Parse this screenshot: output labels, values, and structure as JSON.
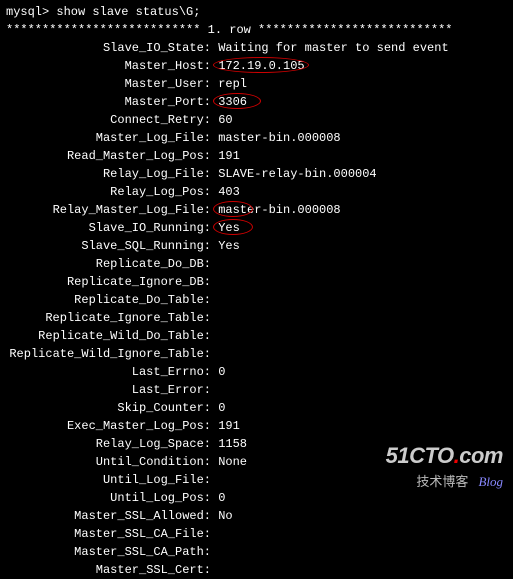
{
  "prompt": "mysql> show slave status\\G;",
  "header": "*************************** 1. row ***************************",
  "fields": [
    {
      "label": "Slave_IO_State",
      "value": "Waiting for master to send event"
    },
    {
      "label": "Master_Host",
      "value": "172.19.0.105"
    },
    {
      "label": "Master_User",
      "value": "repl"
    },
    {
      "label": "Master_Port",
      "value": "3306"
    },
    {
      "label": "Connect_Retry",
      "value": "60"
    },
    {
      "label": "Master_Log_File",
      "value": "master-bin.000008"
    },
    {
      "label": "Read_Master_Log_Pos",
      "value": "191"
    },
    {
      "label": "Relay_Log_File",
      "value": "SLAVE-relay-bin.000004"
    },
    {
      "label": "Relay_Log_Pos",
      "value": "403"
    },
    {
      "label": "Relay_Master_Log_File",
      "value": "master-bin.000008"
    },
    {
      "label": "Slave_IO_Running",
      "value": "Yes"
    },
    {
      "label": "Slave_SQL_Running",
      "value": "Yes"
    },
    {
      "label": "Replicate_Do_DB",
      "value": ""
    },
    {
      "label": "Replicate_Ignore_DB",
      "value": ""
    },
    {
      "label": "Replicate_Do_Table",
      "value": ""
    },
    {
      "label": "Replicate_Ignore_Table",
      "value": ""
    },
    {
      "label": "Replicate_Wild_Do_Table",
      "value": ""
    },
    {
      "label": "Replicate_Wild_Ignore_Table",
      "value": ""
    },
    {
      "label": "Last_Errno",
      "value": "0"
    },
    {
      "label": "Last_Error",
      "value": ""
    },
    {
      "label": "Skip_Counter",
      "value": "0"
    },
    {
      "label": "Exec_Master_Log_Pos",
      "value": "191"
    },
    {
      "label": "Relay_Log_Space",
      "value": "1158"
    },
    {
      "label": "Until_Condition",
      "value": "None"
    },
    {
      "label": "Until_Log_File",
      "value": ""
    },
    {
      "label": "Until_Log_Pos",
      "value": "0"
    },
    {
      "label": "Master_SSL_Allowed",
      "value": "No"
    },
    {
      "label": "Master_SSL_CA_File",
      "value": ""
    },
    {
      "label": "Master_SSL_CA_Path",
      "value": ""
    },
    {
      "label": "Master_SSL_Cert",
      "value": ""
    }
  ],
  "watermark": {
    "main_prefix": "51CTO",
    "main_dot": ".",
    "main_suffix": "com",
    "sub_cn": "技术博客",
    "sub_en": "Blog"
  }
}
